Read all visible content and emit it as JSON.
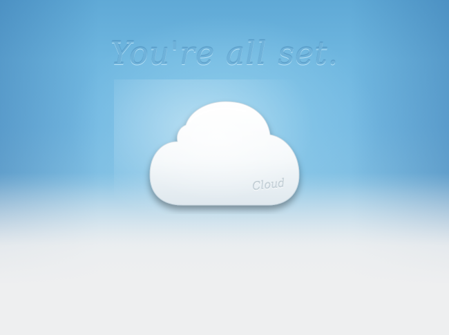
{
  "heading": {
    "text": "You're all set."
  },
  "cloud": {
    "label": "Cloud"
  }
}
